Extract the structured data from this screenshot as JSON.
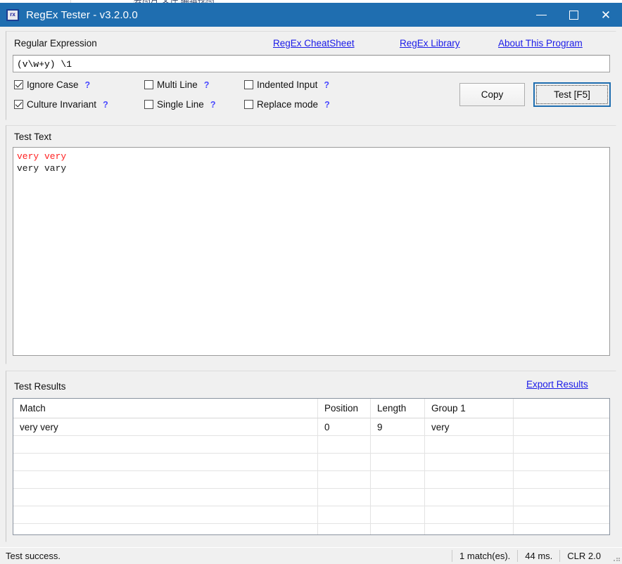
{
  "window": {
    "title": "RegEx Tester - v3.2.0.0",
    "icon": "rx",
    "icon_name": "app-icon",
    "minimize_label": "–",
    "maximize_label": "□",
    "close_label": "✕",
    "accent_color": "#1f6eb0"
  },
  "regex_panel": {
    "label": "Regular Expression",
    "links": [
      {
        "label": "RegEx CheatSheet"
      },
      {
        "label": "RegEx Library"
      },
      {
        "label": "About This Program"
      }
    ],
    "link_color": "#1a1ae8",
    "input_value": "(v\\w+y) \\1",
    "input_placeholder": "",
    "options": [
      {
        "label": "Ignore Case",
        "checked": true,
        "help": "?"
      },
      {
        "label": "Culture Invariant",
        "checked": true,
        "help": "?"
      },
      {
        "label": "Multi Line",
        "checked": false,
        "help": "?"
      },
      {
        "label": "Single Line",
        "checked": false,
        "help": "?"
      },
      {
        "label": "Indented Input",
        "checked": false,
        "help": "?"
      },
      {
        "label": "Replace mode",
        "checked": false,
        "help": "?"
      }
    ],
    "copy_button": "Copy",
    "test_button": "Test [F5]"
  },
  "test_text_panel": {
    "label": "Test Text",
    "lines": [
      {
        "text": "very very",
        "matched": true
      },
      {
        "text": "very vary",
        "matched": false
      }
    ],
    "match_color": "#ff2222"
  },
  "results_panel": {
    "label": "Test Results",
    "export_link": "Export Results",
    "columns": [
      "Match",
      "Position",
      "Length",
      "Group 1",
      ""
    ],
    "rows": [
      [
        "very very",
        "0",
        "9",
        "very",
        ""
      ]
    ],
    "empty_row_count": 6
  },
  "statusbar": {
    "status": "Test success.",
    "matches": "1 match(es).",
    "elapsed": "44 ms.",
    "clr": "CLR 2.0"
  }
}
